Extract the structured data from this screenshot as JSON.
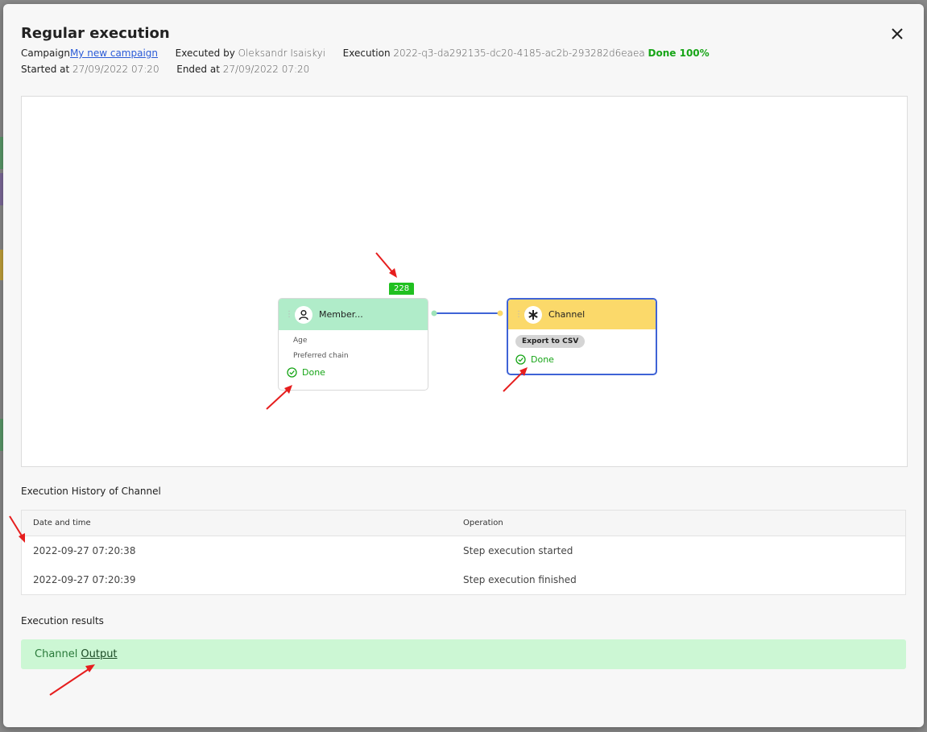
{
  "modal": {
    "title": "Regular execution",
    "close_icon": "close-icon"
  },
  "meta": {
    "campaign_label": "Campaign",
    "campaign_value": "My new campaign",
    "executed_by_label": "Executed by",
    "executed_by_value": "Oleksandr Isaiskyi",
    "execution_label": "Execution",
    "execution_value": "2022-q3-da292135-dc20-4185-ac2b-293282d6eaea",
    "status": "Done 100%",
    "started_label": "Started at",
    "started_value": "27/09/2022 07:20",
    "ended_label": "Ended at",
    "ended_value": "27/09/2022 07:20"
  },
  "flow": {
    "member_node": {
      "title": "Member...",
      "icon": "user-icon",
      "count": "228",
      "attributes": [
        "Age",
        "Preferred chain"
      ],
      "status": "Done"
    },
    "channel_node": {
      "title": "Channel",
      "icon": "asterisk-icon",
      "tag": "Export to CSV",
      "status": "Done"
    }
  },
  "history": {
    "title": "Execution History of Channel",
    "columns": [
      "Date and time",
      "Operation"
    ],
    "rows": [
      [
        "2022-09-27 07:20:38",
        "Step execution started"
      ],
      [
        "2022-09-27 07:20:39",
        "Step execution finished"
      ]
    ]
  },
  "results": {
    "title": "Execution results",
    "channel_label": "Channel",
    "output_link": "Output"
  },
  "colors": {
    "member_head": "#b0ecc9",
    "channel_head": "#fbd96a",
    "channel_border": "#3f63d6",
    "done_green": "#17a517",
    "badge_green": "#20c020",
    "result_bg": "#ccf7d4",
    "annotation_red": "#e61e1e"
  }
}
